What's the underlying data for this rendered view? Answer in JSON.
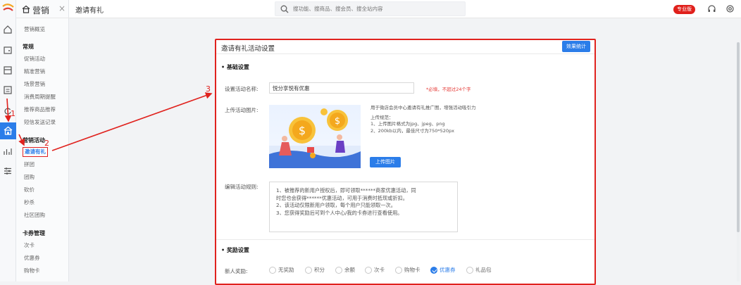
{
  "sidebar_rail": {
    "icons": [
      "logo-icon",
      "home-icon",
      "wallet-icon",
      "archive-icon",
      "clipboard-icon",
      "refresh-icon",
      "marketing-icon",
      "chart-icon",
      "sliders-icon"
    ]
  },
  "submenu": {
    "title": "营销",
    "close": "×",
    "overview": "营销概览",
    "section_normal": "常规",
    "normal_items": [
      "促销活动",
      "精准营销",
      "场景营销",
      "消费周期提醒",
      "推荐商品推荐",
      "短信发送记录"
    ],
    "section_marketing": "营销活动",
    "marketing_items": [
      "邀请有礼",
      "拼团",
      "团购",
      "砍价",
      "秒杀",
      "社区团购"
    ],
    "section_card": "卡券管理",
    "card_items": [
      "次卡",
      "优惠券",
      "购物卡"
    ]
  },
  "topbar": {
    "tab_title": "邀请有礼",
    "search_placeholder": "搜功能、搜商品、搜会员、搜全站内容",
    "edition_badge": "专业版"
  },
  "card": {
    "title": "邀请有礼活动设置",
    "stats_button": "效果统计",
    "basic_section": "• 基础设置",
    "name_label": "设置活动名称:",
    "name_value": "悦分享悦有优惠",
    "name_hint": "*必填，不超过24个字",
    "image_label": "上传活动图片:",
    "image_desc_1": "用于微店会员中心邀请有礼推广图，增强活动吸引力",
    "image_desc_2": "上传规范：",
    "image_desc_3": "1、上传图片格式为jpg、jpeg、png",
    "image_desc_4": "2、200kb以内，最佳尺寸为750*520px",
    "upload_button": "上传图片",
    "rules_label": "编辑活动规则:",
    "rules_lines": [
      "1、被推荐的新用户授权后，即可领取******商家优惠活动，同",
      "时您也会获得******优惠活动，可用于消费时抵现或折扣。",
      "2、该活动仅限新用户领取，每个用户只能领取一次。",
      "3、您获得奖励后可到个人中心/我的卡券进行查看使用。"
    ],
    "reward_section": "• 奖励设置",
    "new_user_label": "新人奖励:",
    "reward_options": [
      "无奖励",
      "积分",
      "余额",
      "次卡",
      "购物卡",
      "优惠券",
      "礼品包"
    ],
    "reward_selected": "优惠券"
  },
  "annotations": {
    "step1": "1",
    "step2": "2",
    "step3": "3",
    "color": "#e0221e"
  }
}
